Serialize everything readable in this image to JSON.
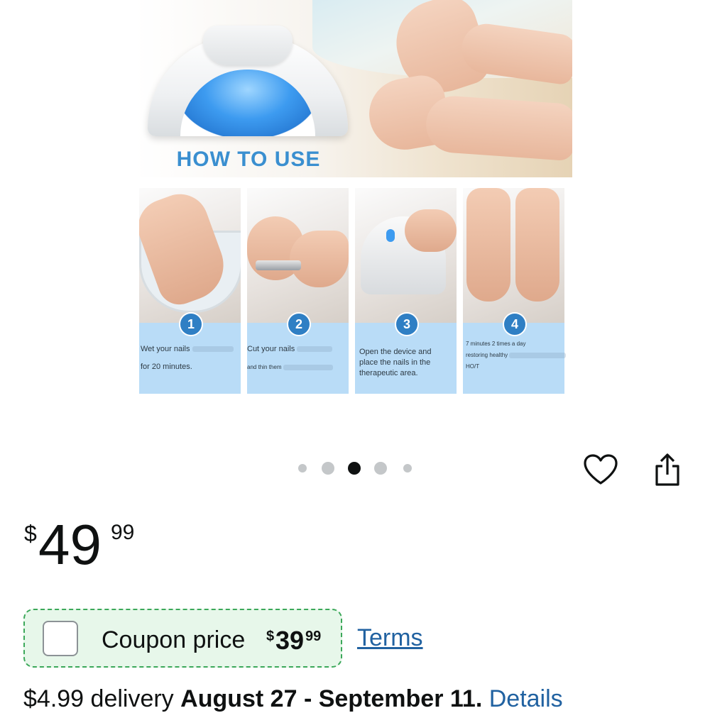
{
  "product_image": {
    "heading": "HOW TO USE",
    "steps": [
      {
        "number": "1",
        "line1": "Wet your nails",
        "line2": "for 20 minutes.",
        "line3": ""
      },
      {
        "number": "2",
        "line1": "Cut your nails",
        "line2": "and thin them",
        "line3": ""
      },
      {
        "number": "3",
        "line1": "Open the device and",
        "line2": "place the nails in the",
        "line3": "therapeutic area."
      },
      {
        "number": "4",
        "line1": "7 minutes 2 times a day",
        "line2": "restoring healthy",
        "line3": "HO/T"
      }
    ]
  },
  "carousel": {
    "dot_count": 5,
    "active_index": 2
  },
  "icons": {
    "wishlist": "heart-outline-icon",
    "share": "share-icon"
  },
  "price": {
    "symbol": "$",
    "whole": "49",
    "fraction": "99"
  },
  "coupon": {
    "label": "Coupon price",
    "symbol": "$",
    "whole": "39",
    "fraction": "99",
    "checked": false,
    "border_color": "#3ca85a",
    "background": "#e7f7ea"
  },
  "terms_link": "Terms",
  "delivery": {
    "prefix": "$4.99 delivery",
    "dates": "August 27 - September 11.",
    "details_link": "Details"
  },
  "colors": {
    "link": "#2162a1",
    "text": "#0f1111"
  }
}
